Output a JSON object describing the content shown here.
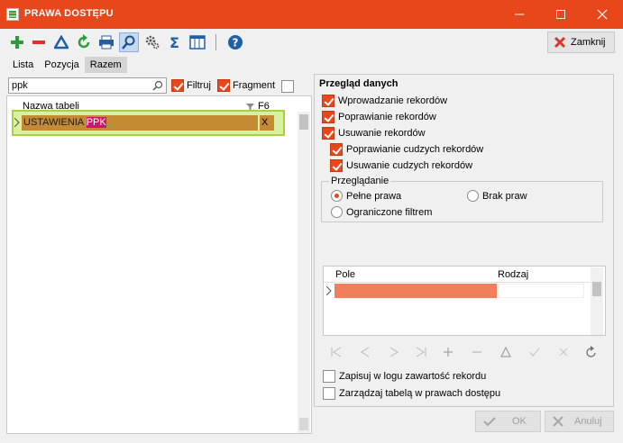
{
  "window": {
    "title": "PRAWA DOSTĘPU",
    "minimize_icon": "minimize-icon",
    "maximize_icon": "maximize-icon",
    "close_icon": "close-icon"
  },
  "toolbar": {
    "icons": [
      "add-icon",
      "remove-icon",
      "delta-icon",
      "refresh-icon",
      "print-icon",
      "search-icon",
      "settings-icon",
      "sigma-icon",
      "columns-icon",
      "help-icon"
    ],
    "close_label": "Zamknij"
  },
  "tabs": [
    {
      "label": "Lista"
    },
    {
      "label": "Pozycja"
    },
    {
      "label": "Razem",
      "active": true
    }
  ],
  "left": {
    "search_value": "ppk",
    "filter_label": "Filtruj",
    "fragment_label": "Fragment",
    "column_header": "Nazwa tabeli",
    "column_shortcut": "F6",
    "rows": [
      {
        "name_prefix": "USTAWIENIA ",
        "name_match": "PPK",
        "mark": "X"
      }
    ]
  },
  "right": {
    "title": "Przegląd danych",
    "perms": [
      {
        "label": "Wprowadzanie rekordów",
        "checked": true
      },
      {
        "label": "Poprawianie rekordów",
        "checked": true
      },
      {
        "label": "Usuwanie rekordów",
        "checked": true
      },
      {
        "label": "Poprawianie cudzych rekordów",
        "checked": true
      },
      {
        "label": "Usuwanie cudzych rekordów",
        "checked": true
      }
    ],
    "browse": {
      "legend": "Przeglądanie",
      "full": "Pełne prawa",
      "none": "Brak praw",
      "filtered": "Ograniczone filtrem",
      "selected": "full"
    },
    "fields": {
      "col_field": "Pole",
      "col_type": "Rodzaj"
    },
    "log_label": "Zapisuj w logu zawartość rekordu",
    "manage_label": "Zarządzaj tabelą w prawach dostępu"
  },
  "buttons": {
    "ok": "OK",
    "cancel": "Anuluj"
  },
  "colors": {
    "accent": "#e8471b",
    "row_highlight": "#c48a34",
    "match_highlight": "#c8186a",
    "selection_border": "#a6d23e",
    "field_highlight": "#f07f5c"
  }
}
